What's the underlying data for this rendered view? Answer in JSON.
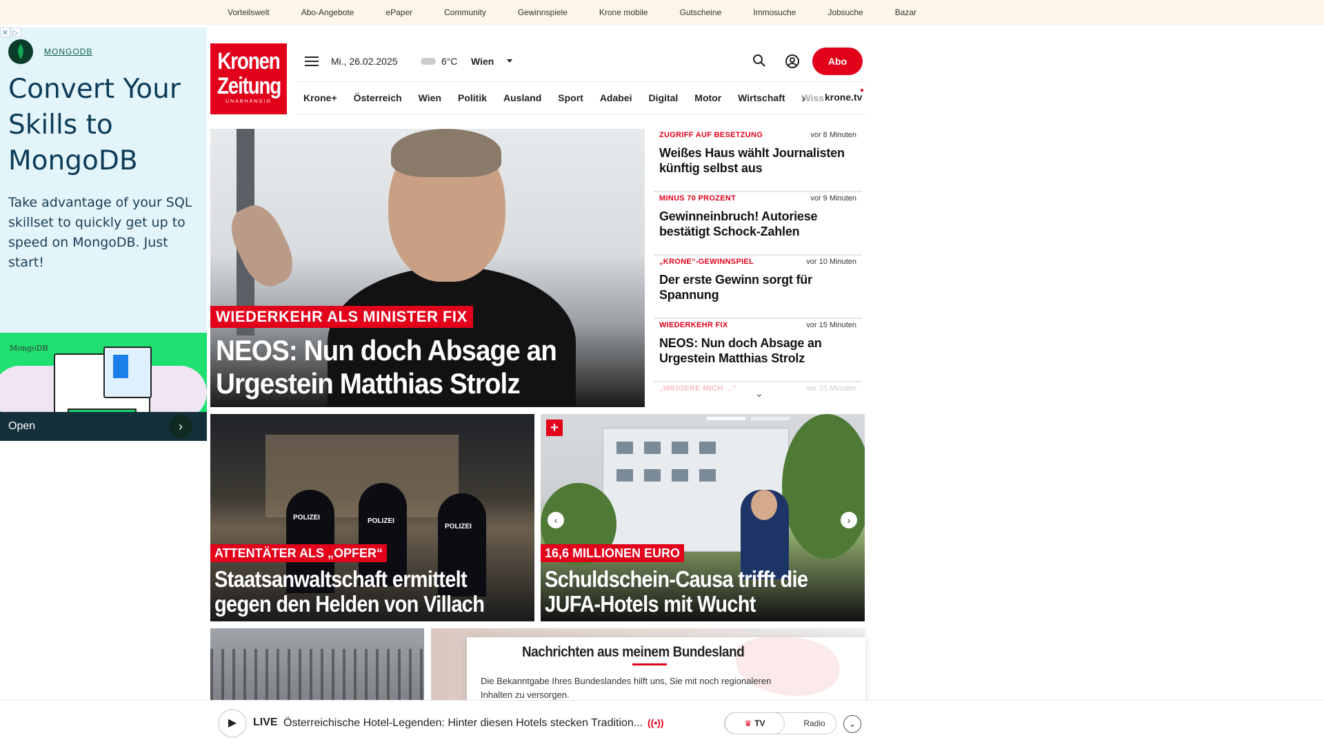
{
  "utilbar": {
    "links": [
      "Vorteilswelt",
      "Abo-Angebote",
      "ePaper",
      "Community",
      "Gewinnspiele",
      "Krone mobile",
      "Gutscheine",
      "Immosuche",
      "Jobsuche",
      "Bazar"
    ]
  },
  "ad": {
    "close_icons": [
      "✕",
      "▷"
    ],
    "brand": "MONGODB",
    "headline": "Convert Your Skills to MongoDB",
    "body": "Take advantage of your SQL skillset to quickly get up to speed on MongoDB. Just start!",
    "image_label": "MongoDB",
    "cta": "Open",
    "arrow": "›",
    "bg_color": "#e3f5fb"
  },
  "header": {
    "logo_line1": "Kronen",
    "logo_line2": "Zeitung",
    "logo_line3": "UNABHÄNGIG",
    "date": "Mi., 26.02.2025",
    "temperature": "6°C",
    "city": "Wien",
    "abo": "Abo",
    "accent": "#e2001a"
  },
  "nav": {
    "items": [
      "Krone+",
      "Österreich",
      "Wien",
      "Politik",
      "Ausland",
      "Sport",
      "Adabei",
      "Digital",
      "Motor",
      "Wirtschaft"
    ],
    "faded_item": "Wiss",
    "more": "›",
    "tv": "krone.tv"
  },
  "hero": {
    "tag": "WIEDERKEHR ALS MINISTER FIX",
    "title": "NEOS: Nun doch Absage an Urgestein Matthias Strolz"
  },
  "ticker": [
    {
      "kicker": "ZUGRIFF AUF BESETZUNG",
      "time": "vor 8 Minuten",
      "title": "Weißes Haus wählt Journalisten künftig selbst aus"
    },
    {
      "kicker": "MINUS 70 PROZENT",
      "time": "vor 9 Minuten",
      "title": "Gewinneinbruch! Autoriese bestätigt Schock-Zahlen"
    },
    {
      "kicker": "„KRONE“-GEWINNSPIEL",
      "time": "vor 10 Minuten",
      "title": "Der erste Gewinn sorgt für Spannung"
    },
    {
      "kicker": "WIEDERKEHR FIX",
      "time": "vor 15 Minuten",
      "title": "NEOS: Nun doch Absage an Urgestein Matthias Strolz"
    },
    {
      "kicker": "„WEIGERE MICH ...“",
      "time": "vor 15 Minuten",
      "title": ""
    }
  ],
  "ticker_chevron": "⌄",
  "cards": [
    {
      "tag": "ATTENTÄTER ALS „OPFER“",
      "title": "Staatsanwaltschaft ermittelt gegen den Helden von Villach",
      "labels": [
        "POLIZEI",
        "POLIZEI",
        "POLIZEI"
      ]
    },
    {
      "tag": "16,6 MILLIONEN EURO",
      "title": "Schuldschein-Causa trifft die JUFA-Hotels mit Wucht",
      "plus": "+",
      "prev": "‹",
      "next": "›"
    }
  ],
  "popup": {
    "title": "Nachrichten aus meinem Bundesland",
    "text": "Die Bekanntgabe Ihres Bundeslandes hilft uns, Sie mit noch regionaleren Inhalten zu versorgen."
  },
  "player": {
    "play": "▶",
    "live": "LIVE",
    "title": "Österreichische Hotel-Legenden: Hinter diesen Hotels stecken Tradition...",
    "radio_icon": "((•))",
    "tv_label": "TV",
    "tv_crown": "♛",
    "radio_label": "Radio",
    "expand": "⌄"
  }
}
